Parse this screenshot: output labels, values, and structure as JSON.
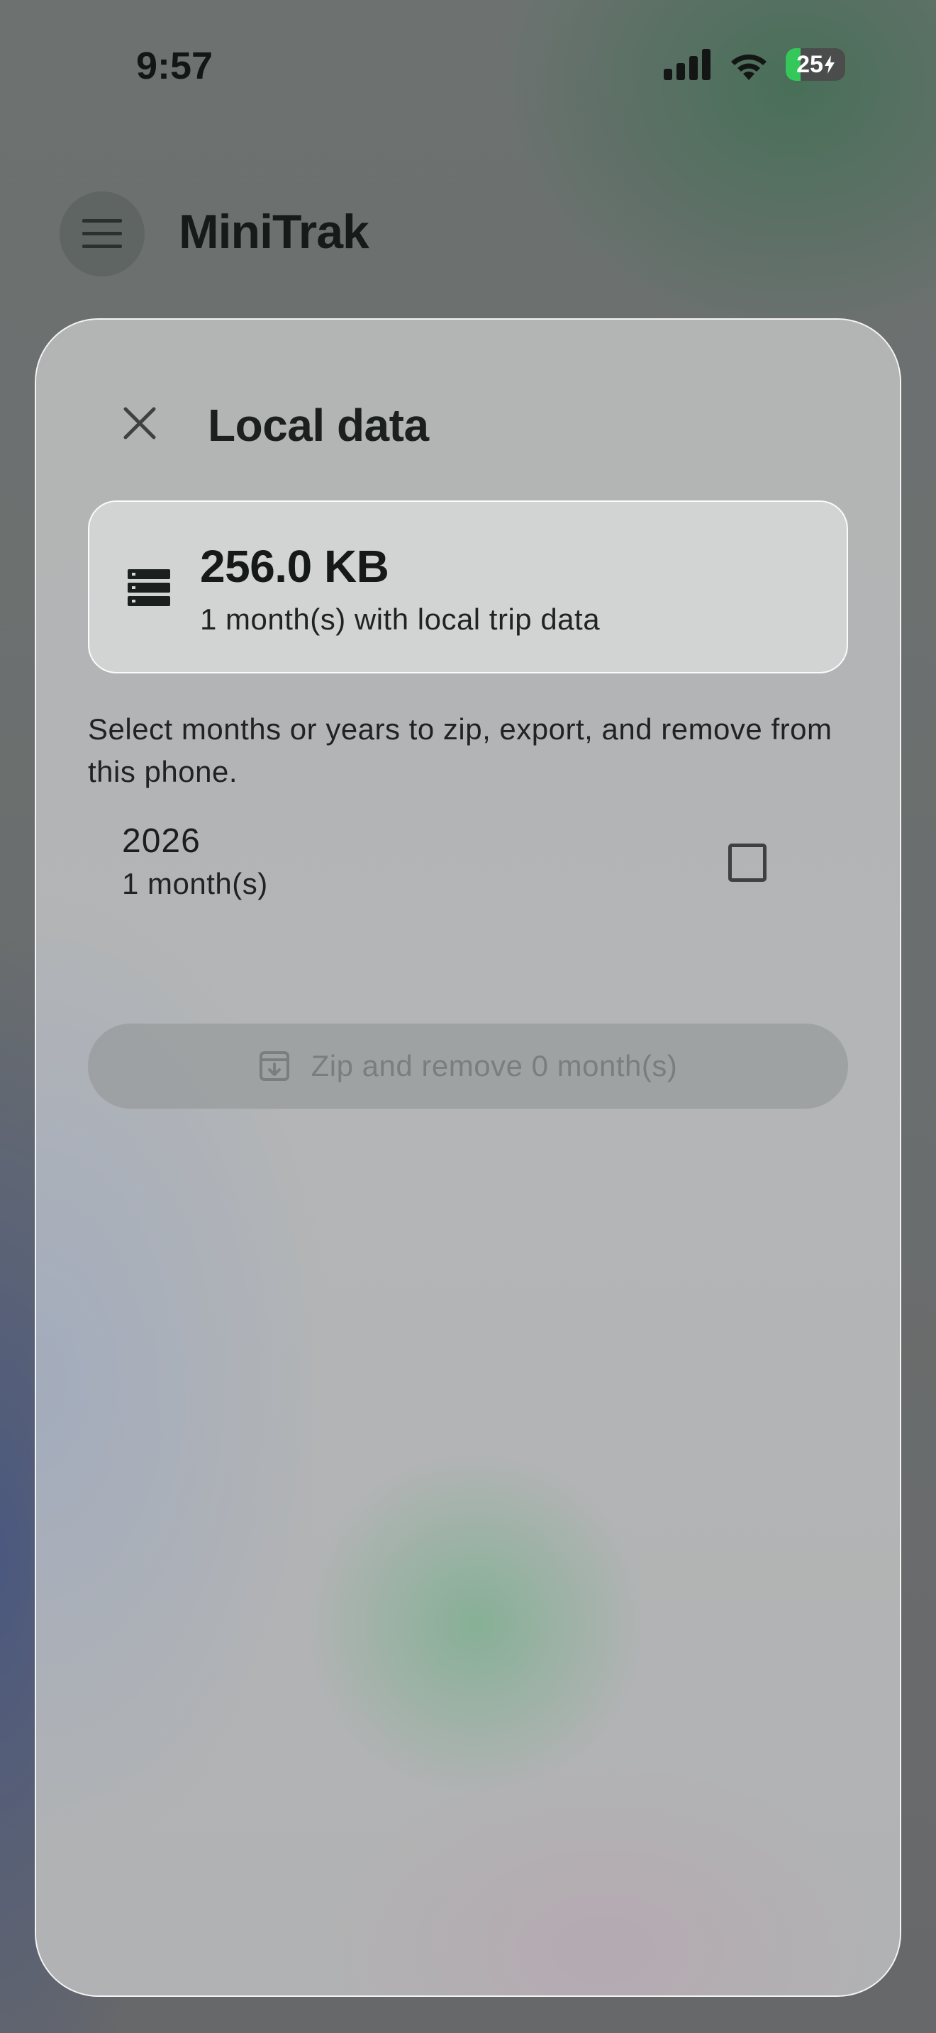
{
  "status_bar": {
    "time": "9:57",
    "battery_level": "25",
    "icons": [
      "cellular-signal-icon",
      "wifi-icon",
      "battery-charging-icon"
    ]
  },
  "header": {
    "app_title": "MiniTrak",
    "menu_icon": "hamburger-menu-icon"
  },
  "sheet": {
    "title": "Local data",
    "close_icon": "close-icon",
    "summary": {
      "size": "256.0 KB",
      "subtitle": "1 month(s) with local trip data",
      "icon": "storage-icon"
    },
    "description": "Select months or years to zip, export, and remove from this phone.",
    "years": [
      {
        "year": "2026",
        "months": "1 month(s)",
        "checked": false
      }
    ],
    "zip_button": {
      "label": "Zip and remove 0 month(s)",
      "icon": "archive-icon",
      "enabled": false
    }
  },
  "colors": {
    "battery_green": "#34c759",
    "text_dark": "#1b201f",
    "disabled_text": "#7a7e7d"
  }
}
